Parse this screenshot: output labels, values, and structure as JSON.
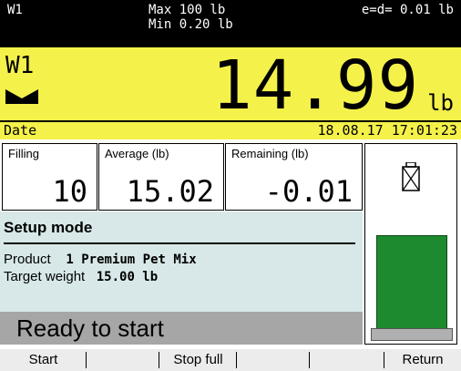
{
  "header": {
    "scale_id": "W1",
    "max": "Max 100 lb",
    "min": "Min 0.20 lb",
    "resolution": "e=d= 0.01 lb"
  },
  "weight": {
    "scale_label": "W1",
    "value": "14.99",
    "unit": "lb",
    "date_label": "Date",
    "date_value": "18.08.17 17:01:23"
  },
  "stats": {
    "filling_label": "Filling",
    "filling_value": "10",
    "average_label": "Average (lb)",
    "average_value": "15.02",
    "remaining_label": "Remaining (lb)",
    "remaining_value": "-0.01"
  },
  "setup": {
    "title": "Setup mode",
    "product_label": "Product",
    "product_value": "1 Premium Pet Mix",
    "target_label": "Target weight",
    "target_value": "15.00 lb",
    "status": "Ready to start"
  },
  "side": {
    "icons": [
      "container-icon",
      "fill-level-bar"
    ],
    "fill_color": "#1e8a2f"
  },
  "softkeys": [
    "Start",
    "",
    "Stop full",
    "",
    "",
    "Return"
  ],
  "colors": {
    "weight_panel": "#f4f14a",
    "setup_panel": "#d8e8e8",
    "status_bar": "#a6a6a6"
  }
}
